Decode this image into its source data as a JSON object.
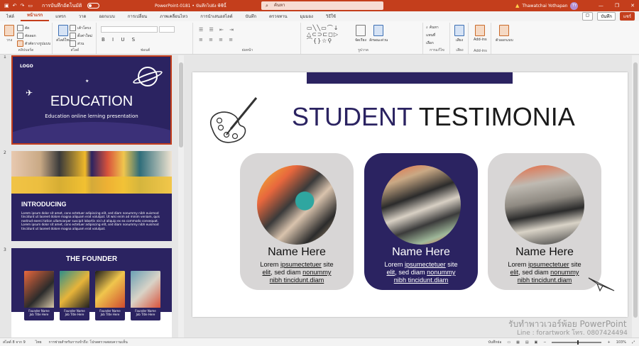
{
  "titlebar": {
    "autosave_label": "การบันทึกอัตโนมัติ",
    "document_title": "PowerPoint-0181 • บันทึกไปยัง พีซีนี้",
    "search_placeholder": "ค้นหา",
    "user_name": "Thawatchai Yothapan",
    "user_initials": "TY"
  },
  "ribbon_tabs": {
    "items": [
      "ไฟล์",
      "หน้าแรก",
      "แทรก",
      "วาด",
      "ออกแบบ",
      "การเปลี่ยน",
      "ภาพเคลื่อนไหว",
      "การนำเสนอสไลด์",
      "บันทึก",
      "ตรวจทาน",
      "มุมมอง",
      "วิธีใช้"
    ],
    "active": "หน้าแรก",
    "record_label": "บันทึก",
    "share_label": "แชร์"
  },
  "ribbon": {
    "groups": [
      "คลิปบอร์ด",
      "สไลด์",
      "ฟอนต์",
      "ย่อหน้า",
      "รูปวาด",
      "การแก้ไข",
      "เสียง",
      "Add-ins"
    ],
    "clipboard": {
      "paste": "วาง",
      "cut": "ตัด",
      "copy": "คัดลอก",
      "painter": "ตัวคัดวางรูปแบบ"
    },
    "slides": {
      "new": "สไลด์ใหม่",
      "layout": "เค้าโครง",
      "reset": "ตั้งค่าใหม่",
      "section": "ส่วน"
    },
    "drawing": {
      "arrange": "จัดเรียง",
      "quick_styles": "ลักษณะด่วน"
    },
    "editing": {
      "find": "ค้นหา",
      "replace": "แทนที่",
      "select": "เลือก"
    },
    "voice": "เสียง",
    "addins": "Add-ins",
    "designer": "ตัวออกแบบ"
  },
  "thumbnails": [
    {
      "number": "1",
      "logo": "LOGO",
      "title": "EDUCATION",
      "subtitle": "Education online lerning presentation"
    },
    {
      "number": "2",
      "title": "INTRODUCING",
      "body": "Lorem ipsum dolor sit amet, cons ectetuer adipiscing elit, sed diam nonummy nibh euismod tincidunt ut laoreet dolore magna aliquam erat volutpat. Ut wisi enim ad minim veniam, quis nostrud exerci tation ullamcorper suscipit lobortis nisl ut aliquip ex ea commodo consequat. Lorem ipsum dolor sit amet, cons ectetuer adipiscing elit, sed diam nonummy nibh euismod tincidunt ut laoreet dolore magna aliquam erat volutpat."
    },
    {
      "number": "3",
      "title": "THE FOUNDER",
      "cards": [
        {
          "name": "Founder Name",
          "role": "Job Title Here"
        },
        {
          "name": "Founder Name",
          "role": "Job Title Here"
        },
        {
          "name": "Founder Name",
          "role": "Job Title Here"
        },
        {
          "name": "Founder Name",
          "role": "Job Title Here"
        }
      ]
    }
  ],
  "slide": {
    "title_part1": "STUDENT",
    "title_part2": "TESTIMONIA",
    "cards": [
      {
        "name": "Name Here",
        "line1": "Lorem ",
        "link1": "ipsumectetuer",
        "line1b": " site",
        "link2": "elit",
        "line2": ", sed diam ",
        "link3": "nonummy",
        "link4": "nibh tincidunt.diam"
      },
      {
        "name": "Name Here",
        "line1": "Lorem ",
        "link1": "ipsumectetuer",
        "line1b": " site",
        "link2": "elit",
        "line2": ", sed diam ",
        "link3": "nonummy",
        "link4": "nibh tincidunt.diam"
      },
      {
        "name": "Name Here",
        "line1": "Lorem ",
        "link1": "ipsumectetuer",
        "line1b": " site",
        "link2": "elit",
        "line2": ", sed diam ",
        "link3": "nonummy",
        "link4": "nibh tincidunt.diam"
      }
    ]
  },
  "watermark": {
    "line1": "รับทำพาวเวอร์พ้อย PowerPoint",
    "line2": "Line : forartwork  โทร. 0807424494"
  },
  "statusbar": {
    "slide_counter": "สไลด์ 8 จาก 9",
    "language": "ไทย",
    "accessibility": "การช่วยสำหรับการเข้าถึง: โปรดตรวจสอบความเห็น",
    "notes": "บันทึกย่อ",
    "zoom": "103%"
  },
  "colors": {
    "accent": "#c43e1c",
    "navy": "#2b2361",
    "card_gray": "#d8d6d6"
  }
}
